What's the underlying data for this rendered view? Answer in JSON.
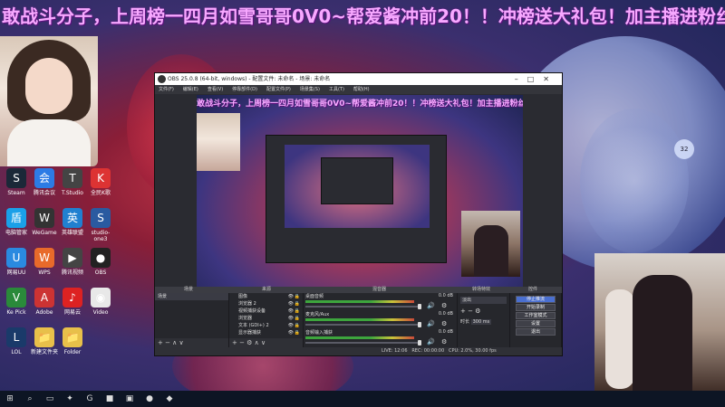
{
  "banner": {
    "text": "敢战斗分子，上周榜一四月如雪哥哥0V0~帮爱酱冲前20！！冲榜送大礼包！加主播进粉丝群"
  },
  "desktop_icons": [
    {
      "label": "Steam",
      "color": "#1b2838",
      "glyph": "S"
    },
    {
      "label": "腾讯会议",
      "color": "#2c7be5",
      "glyph": "会"
    },
    {
      "label": "T.Studio",
      "color": "#444",
      "glyph": "T"
    },
    {
      "label": "全民K歌",
      "color": "#d33",
      "glyph": "K"
    },
    {
      "label": "电脑管家",
      "color": "#1aa0e8",
      "glyph": "盾"
    },
    {
      "label": "WeGame",
      "color": "#333",
      "glyph": "W"
    },
    {
      "label": "英雄联盟",
      "color": "#2080d0",
      "glyph": "英"
    },
    {
      "label": "studio-one3",
      "color": "#2a5aa0",
      "glyph": "S"
    },
    {
      "label": "网易UU",
      "color": "#2a8ae0",
      "glyph": "U"
    },
    {
      "label": "WPS",
      "color": "#e86a2a",
      "glyph": "W"
    },
    {
      "label": "腾讯视频",
      "color": "#444",
      "glyph": "▶"
    },
    {
      "label": "OBS",
      "color": "#222",
      "glyph": "●"
    },
    {
      "label": "Ke Pick",
      "color": "#2a8a3a",
      "glyph": "V"
    },
    {
      "label": "Adobe",
      "color": "#c33",
      "glyph": "A"
    },
    {
      "label": "网易云",
      "color": "#d22",
      "glyph": "♪"
    },
    {
      "label": "Video",
      "color": "#e8e8e8",
      "glyph": "◉"
    },
    {
      "label": "LOL",
      "color": "#1a3a6a",
      "glyph": "L"
    },
    {
      "label": "新建文件夹",
      "color": "#e8c04a",
      "glyph": "📁"
    },
    {
      "label": "Folder",
      "color": "#e8c04a",
      "glyph": "📁"
    }
  ],
  "obs": {
    "title": "OBS 25.0.8 (64-bit, windows) - 配置文件: 未命名 - 场景: 未命名",
    "menu": [
      "文件(F)",
      "编辑(E)",
      "查看(V)",
      "停靠部件(D)",
      "配置文件(P)",
      "场景集(S)",
      "工具(T)",
      "帮助(H)"
    ],
    "docks": {
      "scenes": "场景",
      "sources": "来源",
      "mixer": "混音器",
      "transitions": "转场特效",
      "controls": "控件"
    },
    "scene_items": [
      "场景"
    ],
    "source_items": [
      "图像",
      "浏览器 2",
      "视频捕获设备",
      "浏览器",
      "文本 (GDI+) 2",
      "显示器捕获"
    ],
    "mixer_items": [
      {
        "name": "桌面音频",
        "db": "0.0 dB"
      },
      {
        "name": "麦克风/Aux",
        "db": "0.0 dB"
      },
      {
        "name": "音频输入捕获",
        "db": "0.0 dB"
      }
    ],
    "transition": {
      "type": "淡出",
      "duration_label": "时长",
      "duration": "300 ms"
    },
    "controls": [
      "停止推流",
      "开始录制",
      "工作室模式",
      "设置",
      "退出"
    ],
    "status": {
      "live": "LIVE: 12:06",
      "rec": "REC: 00:00:00",
      "cpu": "CPU: 2.0%, 30.00 fps"
    }
  },
  "badge": "32",
  "taskbar": [
    {
      "name": "start-icon",
      "glyph": "⊞"
    },
    {
      "name": "search-icon",
      "glyph": "⌕"
    },
    {
      "name": "task-view-icon",
      "glyph": "▭"
    },
    {
      "name": "app-icon",
      "glyph": "✦"
    },
    {
      "name": "app-icon",
      "glyph": "G"
    },
    {
      "name": "folder-icon",
      "glyph": "■"
    },
    {
      "name": "app-icon",
      "glyph": "▣"
    },
    {
      "name": "obs-icon",
      "glyph": "●"
    },
    {
      "name": "app-icon",
      "glyph": "◆"
    }
  ]
}
